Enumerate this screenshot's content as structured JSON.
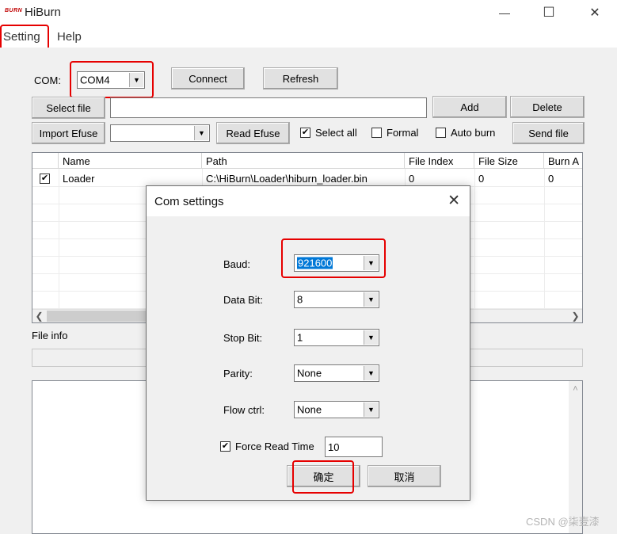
{
  "app": {
    "logo_text": "BURN",
    "title": "HiBurn"
  },
  "window_controls": {
    "minimize": "—",
    "maximize": "☐",
    "close": "✕"
  },
  "menu": [
    "Setting",
    "Help"
  ],
  "toolbar": {
    "com_label": "COM:",
    "com_value": "COM4",
    "connect": "Connect",
    "refresh": "Refresh",
    "select_file": "Select file",
    "file_path": "",
    "add": "Add",
    "delete": "Delete",
    "import_efuse": "Import Efuse",
    "efuse_value": "",
    "read_efuse": "Read Efuse",
    "select_all": "Select all",
    "formal": "Formal",
    "auto_burn": "Auto burn",
    "send_file": "Send file"
  },
  "checks": {
    "select_all": true,
    "formal": false,
    "auto_burn": false
  },
  "table": {
    "columns": [
      "",
      "Name",
      "Path",
      "File Index",
      "File Size",
      "Burn A"
    ],
    "rows": [
      {
        "checked": true,
        "name": "Loader",
        "path": "C:\\HiBurn\\Loader\\hiburn_loader.bin",
        "index": "0",
        "size": "0",
        "burn": "0"
      }
    ]
  },
  "file_info_label": "File info",
  "dialog": {
    "title": "Com settings",
    "baud_label": "Baud:",
    "baud_value": "921600",
    "databit_label": "Data Bit:",
    "databit_value": "8",
    "stopbit_label": "Stop Bit:",
    "stopbit_value": "1",
    "parity_label": "Parity:",
    "parity_value": "None",
    "flowctrl_label": "Flow ctrl:",
    "flowctrl_value": "None",
    "force_read_label": "Force Read Time",
    "force_read_checked": true,
    "force_read_value": "10",
    "ok": "确定",
    "cancel": "取消"
  },
  "watermark": "CSDN @柒壹漆",
  "colors": {
    "highlight": "#e60000",
    "selection": "#0078d7"
  }
}
